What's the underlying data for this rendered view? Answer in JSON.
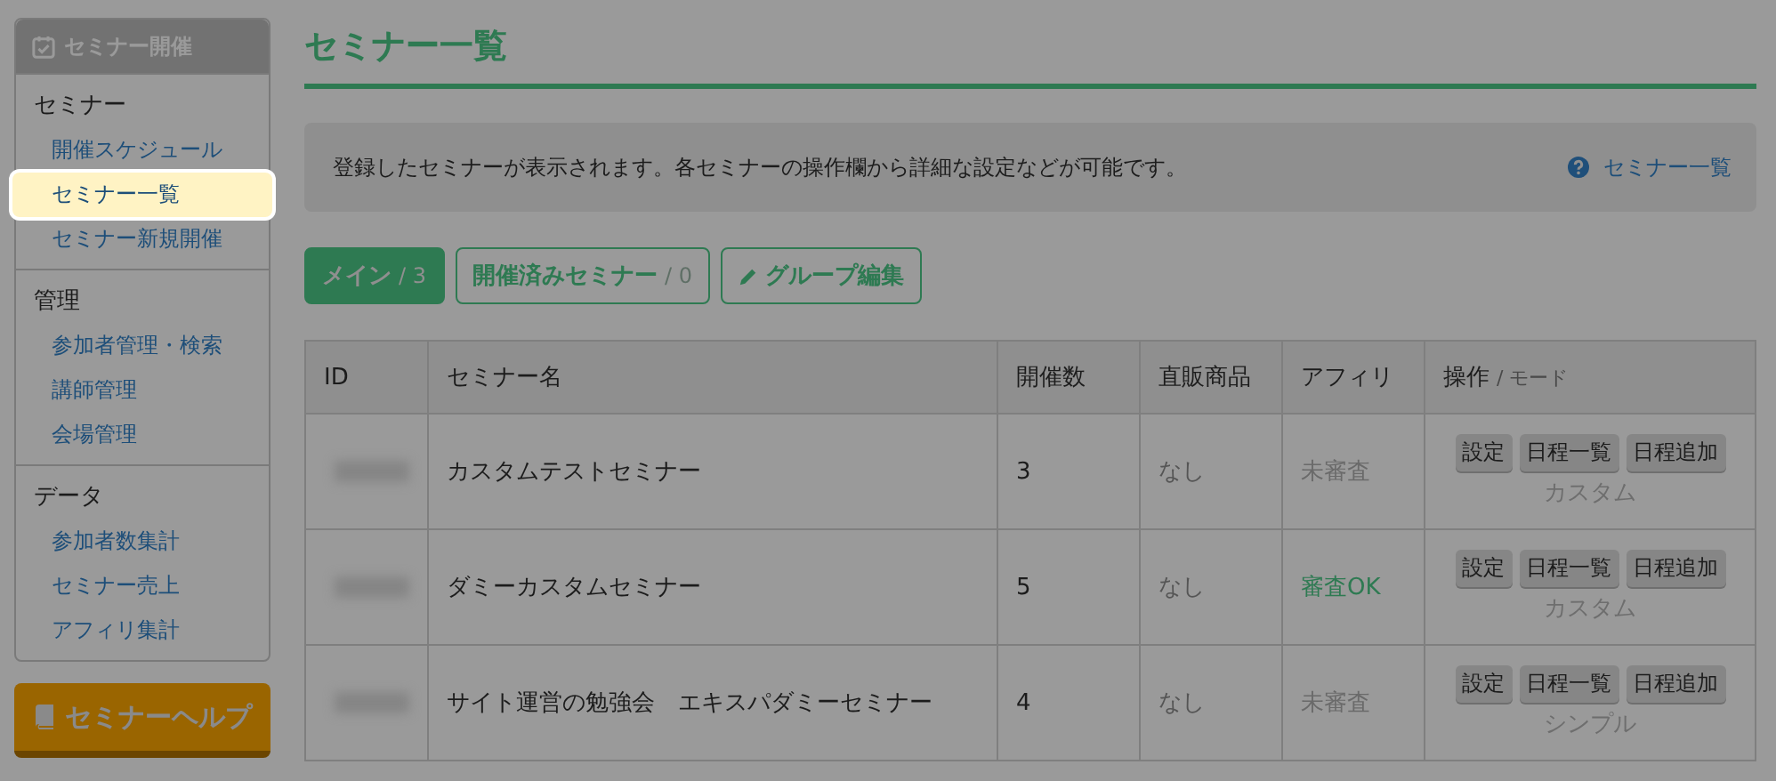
{
  "sidebar": {
    "header": "セミナー開催",
    "sections": [
      {
        "title": "セミナー",
        "items": [
          {
            "label": "開催スケジュール",
            "selected": false
          },
          {
            "label": "セミナー一覧",
            "selected": true
          },
          {
            "label": "セミナー新規開催",
            "selected": false
          }
        ]
      },
      {
        "title": "管理",
        "items": [
          {
            "label": "参加者管理・検索",
            "selected": false
          },
          {
            "label": "講師管理",
            "selected": false
          },
          {
            "label": "会場管理",
            "selected": false
          }
        ]
      },
      {
        "title": "データ",
        "items": [
          {
            "label": "参加者数集計",
            "selected": false
          },
          {
            "label": "セミナー売上",
            "selected": false
          },
          {
            "label": "アフィリ集計",
            "selected": false
          }
        ]
      }
    ],
    "help_button": "セミナーヘルプ"
  },
  "page_title": "セミナー一覧",
  "info": {
    "text": "登録したセミナーが表示されます。各セミナーの操作欄から詳細な設定などが可能です。",
    "help_link": "セミナー一覧"
  },
  "tabs": [
    {
      "label": "メイン",
      "count": "/ 3",
      "selected": true
    },
    {
      "label": "開催済みセミナー",
      "count": "/ 0",
      "selected": false
    }
  ],
  "group_edit_button": "グループ編集",
  "table": {
    "columns": [
      "ID",
      "セミナー名",
      "開催数",
      "直販商品",
      "アフィリ",
      "操作"
    ],
    "column_note": "/ モード",
    "rows": [
      {
        "name": "カスタムテストセミナー",
        "count": "3",
        "product": "なし",
        "affiliate": "未審査",
        "approved": false,
        "actions": [
          "設定",
          "日程一覧",
          "日程追加"
        ],
        "mode": "カスタム"
      },
      {
        "name": "ダミーカスタムセミナー",
        "count": "5",
        "product": "なし",
        "affiliate": "審査OK",
        "approved": true,
        "actions": [
          "設定",
          "日程一覧",
          "日程追加"
        ],
        "mode": "カスタム"
      },
      {
        "name": "サイト運営の勉強会　エキスパダミーセミナー",
        "count": "4",
        "product": "なし",
        "affiliate": "未審査",
        "approved": false,
        "actions": [
          "設定",
          "日程一覧",
          "日程追加"
        ],
        "mode": "シンプル"
      }
    ]
  }
}
